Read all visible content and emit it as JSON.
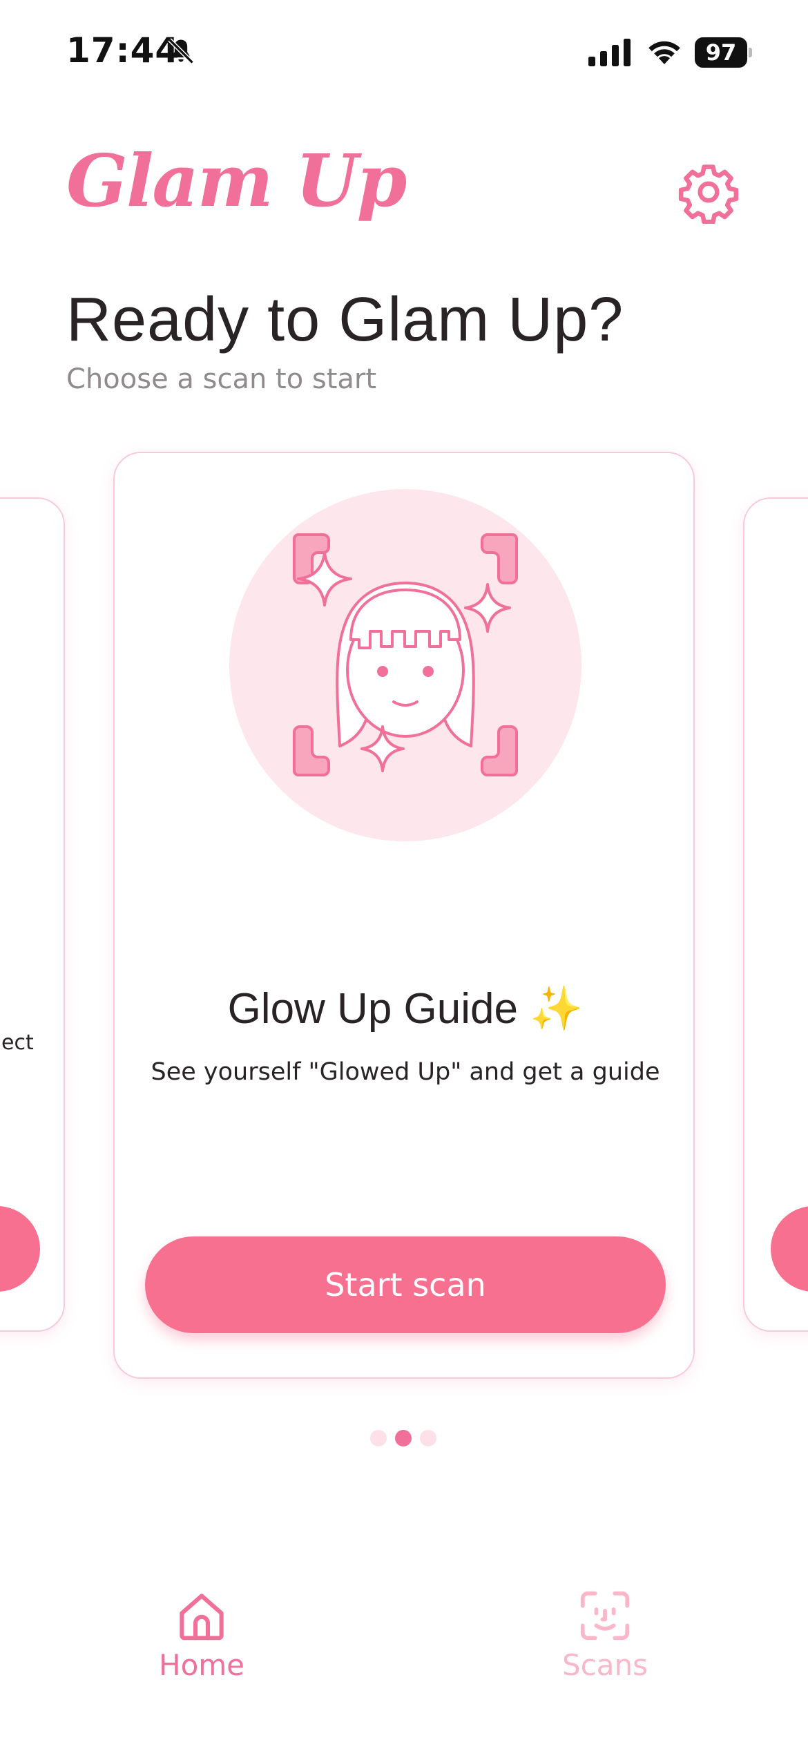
{
  "status_bar": {
    "time": "17:44",
    "battery": "97",
    "icons": [
      "bell-slash-icon",
      "signal-icon",
      "wifi-icon",
      "battery-icon"
    ]
  },
  "header": {
    "logo": "Glam Up",
    "title": "Ready to Glam Up?",
    "subtitle": "Choose a scan to start",
    "settings_icon": "gear-icon"
  },
  "carousel": {
    "current_card": {
      "title": "Glow Up Guide",
      "emoji": "✨",
      "description": "See yourself \"Glowed Up\" and get a guide",
      "button_label": "Start scan",
      "illustration_icon": "face-scan-sparkle-icon"
    },
    "left_card_partial_text": "ect",
    "page_count": 3,
    "active_page": 2
  },
  "tab_bar": {
    "items": [
      {
        "label": "Home",
        "icon": "home-icon",
        "active": true
      },
      {
        "label": "Scans",
        "icon": "face-scan-icon",
        "active": false
      }
    ]
  },
  "colors": {
    "accent": "#f0709a",
    "button": "#f7708f",
    "circle_bg": "#fde6ec",
    "text": "#2a2325",
    "muted": "#8f8a8c"
  }
}
